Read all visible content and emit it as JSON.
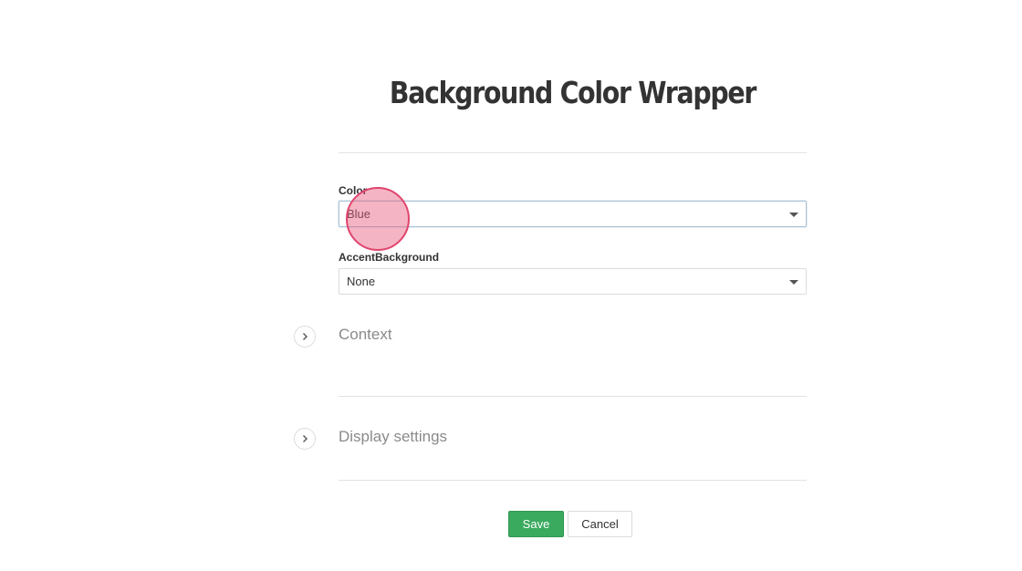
{
  "page": {
    "title": "Background Color Wrapper"
  },
  "form": {
    "color": {
      "label": "Color",
      "value": "Blue"
    },
    "accent_background": {
      "label": "AccentBackground",
      "value": "None"
    }
  },
  "sections": [
    {
      "title": "Context",
      "expanded": false,
      "icon": "chevron-right-icon"
    },
    {
      "title": "Display settings",
      "expanded": false,
      "icon": "chevron-right-icon"
    }
  ],
  "actions": {
    "save_label": "Save",
    "cancel_label": "Cancel"
  },
  "colors": {
    "save_button": "#3aaa5f",
    "click_indicator": "#e8587a"
  }
}
